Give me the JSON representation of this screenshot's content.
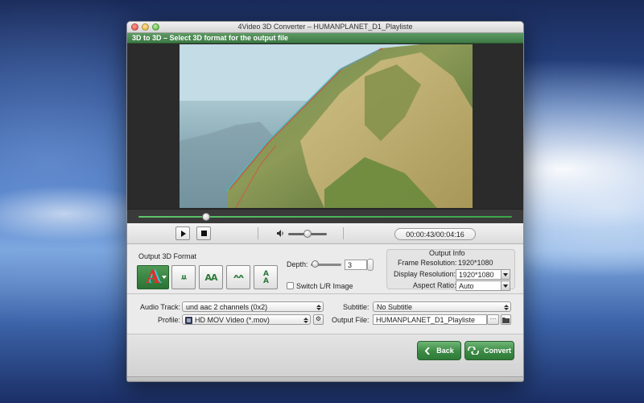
{
  "window": {
    "title": "4Video 3D Converter – HUMANPLANET_D1_Playliste"
  },
  "step": {
    "text": "3D to 3D – Select 3D format for the output file"
  },
  "playback": {
    "time": "00:00:43/00:04:16",
    "progress_fraction": 0.18,
    "volume_fraction": 0.5
  },
  "format": {
    "heading": "Output 3D Format",
    "buttons": [
      {
        "glyph": "A"
      },
      {
        "glyph": "AA"
      },
      {
        "glyph": "AA"
      },
      {
        "glyph": "AA"
      },
      {
        "glyph": "AA"
      }
    ],
    "depth_label": "Depth:",
    "depth_value": "3",
    "switch_label": "Switch L/R Image",
    "switch_checked": false
  },
  "output_info": {
    "heading": "Output Info",
    "frame_res_label": "Frame Resolution:",
    "frame_res_value": "1920*1080",
    "display_res_label": "Display Resolution:",
    "display_res_value": "1920*1080",
    "aspect_label": "Aspect Ratio:",
    "aspect_value": "Auto"
  },
  "output": {
    "audio_label": "Audio Track:",
    "audio_value": "und aac 2 channels (0x2)",
    "profile_label": "Profile:",
    "profile_value": "HD MOV Video (*.mov)",
    "subtitle_label": "Subtitle:",
    "subtitle_value": "No Subtitle",
    "output_file_label": "Output File:",
    "output_file_value": "HUMANPLANET_D1_Playliste",
    "browse_label": "···"
  },
  "actions": {
    "back_label": "Back",
    "convert_label": "Convert"
  },
  "icons": {
    "play": "play-icon",
    "stop": "stop-icon",
    "volume": "speaker-icon",
    "folder": "folder-icon",
    "settings": "gear-icon"
  }
}
